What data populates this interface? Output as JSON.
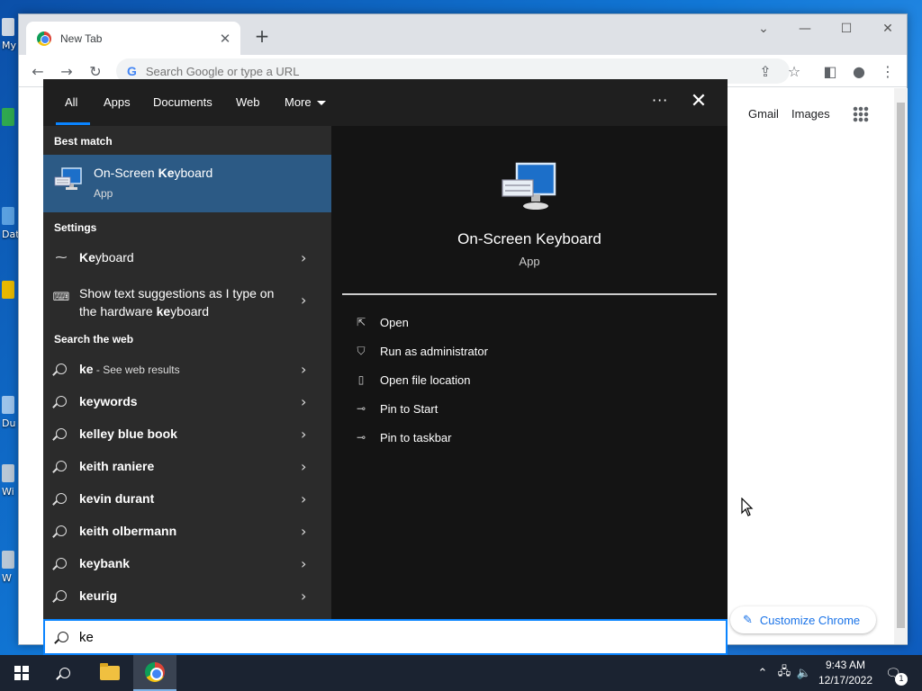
{
  "desktop": {
    "icons": [
      {
        "label": "My"
      },
      {
        "label": "Dat"
      },
      {
        "label": "Du"
      },
      {
        "label": "Wi"
      },
      {
        "label": "W"
      }
    ]
  },
  "chrome": {
    "tab_title": "New Tab",
    "omnibox_placeholder": "Search Google or type a URL",
    "omnibox_g": "G",
    "ntp": {
      "gmail": "Gmail",
      "images": "Images",
      "customize": "Customize Chrome"
    }
  },
  "search": {
    "scopes": [
      "All",
      "Apps",
      "Documents",
      "Web",
      "More"
    ],
    "best_match_heading": "Best match",
    "best_match": {
      "title_pre": "On-Screen ",
      "title_bold": "Ke",
      "title_post": "yboard",
      "subtitle": "App"
    },
    "settings_heading": "Settings",
    "settings": [
      {
        "pre": "",
        "bold": "Ke",
        "post": "yboard"
      },
      {
        "pre": "Show text suggestions as I type on the hardware ",
        "bold": "ke",
        "post": "yboard"
      }
    ],
    "web_heading": "Search the web",
    "web_results": [
      {
        "pre": "",
        "bold": "ke",
        "post": "",
        "sub": " - See web results"
      },
      {
        "pre": "",
        "bold": "keywords",
        "post": "",
        "sub": ""
      },
      {
        "pre": "",
        "bold": "kelley blue book",
        "post": "",
        "sub": ""
      },
      {
        "pre": "",
        "bold": "keith raniere",
        "post": "",
        "sub": ""
      },
      {
        "pre": "",
        "bold": "kevin durant",
        "post": "",
        "sub": ""
      },
      {
        "pre": "",
        "bold": "keith olbermann",
        "post": "",
        "sub": ""
      },
      {
        "pre": "",
        "bold": "keybank",
        "post": "",
        "sub": ""
      },
      {
        "pre": "",
        "bold": "keurig",
        "post": "",
        "sub": ""
      }
    ],
    "preview": {
      "title": "On-Screen Keyboard",
      "subtitle": "App",
      "actions": [
        {
          "label": "Open",
          "icon": "open-icon"
        },
        {
          "label": "Run as administrator",
          "icon": "shield-icon"
        },
        {
          "label": "Open file location",
          "icon": "file-location-icon"
        },
        {
          "label": "Pin to Start",
          "icon": "pin-icon"
        },
        {
          "label": "Pin to taskbar",
          "icon": "pin-icon"
        }
      ]
    },
    "query": "ke"
  },
  "taskbar": {
    "time": "9:43 AM",
    "date": "12/17/2022",
    "notification_count": "1"
  },
  "colors": {
    "accent": "#0a84ff",
    "best_match_bg": "#2c5a85",
    "panel_bg": "#2b2b2b",
    "preview_bg": "#141414",
    "taskbar_bg": "#1b2331"
  }
}
